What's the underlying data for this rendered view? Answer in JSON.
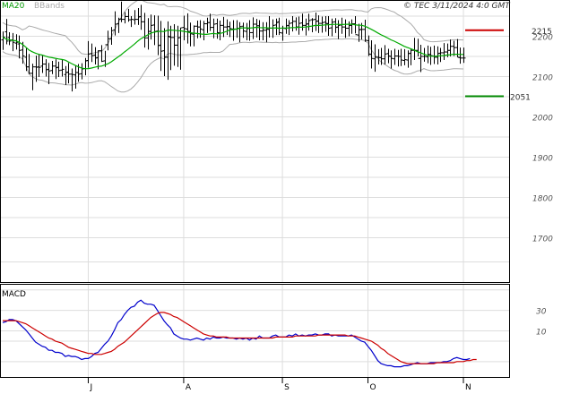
{
  "header": {
    "legend_ma": "MA20",
    "legend_bb": "BBands",
    "watermark": "© TEC 3/11/2024 4:0 GMT"
  },
  "macd_label": "MACD",
  "colors": {
    "price": "#000000",
    "ma20": "#00aa00",
    "bbands": "#aaaaaa",
    "resistance": "#cc0000",
    "support": "#008800",
    "macd": "#0000cc",
    "signal": "#cc0000",
    "grid": "#dddddd",
    "panel_border": "#000000"
  },
  "chart_data": [
    {
      "type": "ohlc",
      "ylim": [
        1590,
        2290
      ],
      "yticks": [
        1700,
        1800,
        1900,
        2000,
        2100,
        2200
      ],
      "x_months": [
        {
          "label": "J",
          "index": 26
        },
        {
          "label": "A",
          "index": 55
        },
        {
          "label": "S",
          "index": 85
        },
        {
          "label": "O",
          "index": 111
        },
        {
          "label": "N",
          "index": 140
        }
      ],
      "levels": [
        {
          "name": "resistance",
          "value": 2215,
          "label": "2215"
        },
        {
          "name": "support",
          "value": 2051,
          "label": "2051"
        }
      ],
      "series": {
        "high": [
          2212,
          2243,
          2210,
          2208,
          2205,
          2202,
          2186,
          2170,
          2156,
          2132,
          2152,
          2156,
          2152,
          2143,
          2134,
          2139,
          2143,
          2137,
          2142,
          2126,
          2134,
          2120,
          2128,
          2131,
          2133,
          2146,
          2188,
          2182,
          2173,
          2165,
          2178,
          2164,
          2214,
          2223,
          2262,
          2246,
          2286,
          2260,
          2268,
          2250,
          2265,
          2270,
          2278,
          2258,
          2245,
          2254,
          2252,
          2251,
          2238,
          2220,
          2237,
          2226,
          2230,
          2226,
          2221,
          2251,
          2257,
          2234,
          2227,
          2239,
          2240,
          2238,
          2246,
          2256,
          2244,
          2244,
          2239,
          2248,
          2242,
          2236,
          2240,
          2240,
          2235,
          2234,
          2233,
          2240,
          2247,
          2243,
          2240,
          2235,
          2235,
          2250,
          2242,
          2244,
          2246,
          2226,
          2244,
          2240,
          2250,
          2247,
          2249,
          2256,
          2244,
          2256,
          2245,
          2259,
          2252,
          2249,
          2250,
          2250,
          2244,
          2245,
          2240,
          2246,
          2242,
          2237,
          2242,
          2250,
          2231,
          2233,
          2241,
          2202,
          2190,
          2180,
          2168,
          2171,
          2178,
          2169,
          2165,
          2169,
          2166,
          2169,
          2168,
          2165,
          2168,
          2196,
          2194,
          2179,
          2171,
          2177,
          2174,
          2177,
          2175,
          2171,
          2183,
          2182,
          2192,
          2189,
          2193,
          2172,
          2172
        ],
        "low": [
          2166,
          2180,
          2178,
          2163,
          2167,
          2145,
          2132,
          2114,
          2106,
          2066,
          2087,
          2099,
          2109,
          2100,
          2081,
          2106,
          2094,
          2099,
          2100,
          2079,
          2083,
          2063,
          2070,
          2087,
          2093,
          2103,
          2122,
          2136,
          2130,
          2118,
          2136,
          2124,
          2165,
          2179,
          2202,
          2208,
          2235,
          2232,
          2236,
          2223,
          2229,
          2228,
          2216,
          2172,
          2167,
          2192,
          2178,
          2153,
          2114,
          2101,
          2092,
          2116,
          2127,
          2124,
          2117,
          2190,
          2182,
          2175,
          2175,
          2195,
          2196,
          2190,
          2208,
          2213,
          2195,
          2194,
          2190,
          2198,
          2203,
          2198,
          2189,
          2196,
          2185,
          2196,
          2190,
          2189,
          2193,
          2197,
          2190,
          2190,
          2185,
          2197,
          2196,
          2203,
          2203,
          2189,
          2206,
          2203,
          2212,
          2214,
          2204,
          2214,
          2202,
          2214,
          2210,
          2213,
          2208,
          2209,
          2211,
          2201,
          2200,
          2208,
          2193,
          2206,
          2196,
          2200,
          2206,
          2207,
          2186,
          2192,
          2186,
          2151,
          2120,
          2112,
          2130,
          2129,
          2130,
          2133,
          2120,
          2129,
          2125,
          2126,
          2128,
          2122,
          2128,
          2141,
          2150,
          2111,
          2137,
          2133,
          2129,
          2131,
          2130,
          2136,
          2141,
          2148,
          2150,
          2151,
          2148,
          2132,
          2134
        ],
        "open": [
          2191,
          2211,
          2197,
          2191,
          2183,
          2181,
          2166,
          2148,
          2124,
          2108,
          2124,
          2124,
          2126,
          2131,
          2118,
          2115,
          2126,
          2123,
          2116,
          2105,
          2111,
          2106,
          2104,
          2110,
          2107,
          2120,
          2140,
          2157,
          2153,
          2147,
          2164,
          2139,
          2179,
          2194,
          2216,
          2231,
          2243,
          2242,
          2249,
          2241,
          2241,
          2242,
          2249,
          2236,
          2196,
          2212,
          2228,
          2213,
          2178,
          2164,
          2148,
          2198,
          2197,
          2178,
          2197,
          2222,
          2218,
          2212,
          2205,
          2225,
          2223,
          2216,
          2231,
          2234,
          2222,
          2231,
          2208,
          2227,
          2223,
          2224,
          2218,
          2218,
          2220,
          2225,
          2212,
          2220,
          2209,
          2230,
          2226,
          2213,
          2215,
          2217,
          2220,
          2228,
          2236,
          2208,
          2219,
          2227,
          2233,
          2237,
          2223,
          2233,
          2227,
          2231,
          2241,
          2242,
          2238,
          2232,
          2235,
          2231,
          2221,
          2236,
          2223,
          2228,
          2223,
          2220,
          2227,
          2231,
          2203,
          2217,
          2217,
          2189,
          2155,
          2144,
          2148,
          2147,
          2144,
          2157,
          2150,
          2144,
          2151,
          2150,
          2140,
          2141,
          2158,
          2165,
          2165,
          2145,
          2150,
          2149,
          2155,
          2151,
          2148,
          2158,
          2159,
          2161,
          2165,
          2175,
          2172,
          2147,
          2146
        ],
        "close": [
          2198,
          2188,
          2188,
          2185,
          2185,
          2165,
          2151,
          2124,
          2108,
          2124,
          2123,
          2123,
          2131,
          2117,
          2114,
          2126,
          2122,
          2115,
          2118,
          2110,
          2106,
          2105,
          2110,
          2106,
          2119,
          2139,
          2156,
          2152,
          2146,
          2164,
          2138,
          2179,
          2194,
          2214,
          2230,
          2242,
          2242,
          2249,
          2241,
          2242,
          2242,
          2248,
          2236,
          2196,
          2212,
          2227,
          2212,
          2177,
          2163,
          2148,
          2200,
          2197,
          2178,
          2196,
          2221,
          2219,
          2212,
          2206,
          2225,
          2223,
          2218,
          2231,
          2234,
          2222,
          2230,
          2209,
          2227,
          2223,
          2224,
          2219,
          2218,
          2220,
          2224,
          2213,
          2219,
          2209,
          2230,
          2226,
          2213,
          2215,
          2218,
          2220,
          2227,
          2234,
          2209,
          2220,
          2226,
          2232,
          2237,
          2223,
          2232,
          2227,
          2230,
          2239,
          2241,
          2237,
          2232,
          2234,
          2232,
          2220,
          2235,
          2222,
          2227,
          2223,
          2220,
          2227,
          2231,
          2204,
          2216,
          2217,
          2190,
          2156,
          2145,
          2148,
          2147,
          2144,
          2156,
          2151,
          2145,
          2151,
          2150,
          2141,
          2142,
          2157,
          2165,
          2165,
          2145,
          2150,
          2150,
          2155,
          2152,
          2148,
          2157,
          2159,
          2161,
          2165,
          2175,
          2172,
          2148,
          2146,
          2146
        ]
      }
    },
    {
      "type": "line",
      "title": "MACD",
      "ylim": [
        -35,
        55
      ],
      "yticks": [
        10,
        30
      ],
      "series": [
        {
          "key": "macd",
          "values": [
            18,
            19,
            21,
            21,
            20,
            17,
            14,
            11,
            7,
            3,
            -1,
            -3,
            -5,
            -6,
            -9,
            -9,
            -11,
            -11,
            -12,
            -15,
            -14,
            -15,
            -15,
            -16,
            -18,
            -17,
            -17,
            -15,
            -12,
            -11,
            -7,
            -3,
            0,
            5,
            11,
            18,
            21,
            26,
            30,
            33,
            34,
            38,
            40,
            37,
            36,
            36,
            35,
            30,
            25,
            20,
            16,
            13,
            7,
            5,
            3,
            2,
            2,
            1,
            2,
            3,
            2,
            1,
            3,
            2,
            4,
            3,
            3,
            4,
            3,
            3,
            3,
            2,
            3,
            2,
            3,
            1,
            3,
            2,
            5,
            3,
            3,
            3,
            5,
            6,
            4,
            4,
            4,
            6,
            5,
            7,
            5,
            6,
            5,
            6,
            6,
            7,
            6,
            6,
            7,
            7,
            5,
            6,
            5,
            5,
            5,
            5,
            6,
            4,
            2,
            0,
            -1,
            -5,
            -9,
            -14,
            -19,
            -22,
            -23,
            -24,
            -24,
            -25,
            -25,
            -25,
            -24,
            -24,
            -23,
            -22,
            -21,
            -22,
            -22,
            -22,
            -21,
            -21,
            -21,
            -21,
            -20,
            -20,
            -19,
            -17,
            -16,
            -17,
            -18,
            -18,
            -17
          ]
        },
        {
          "key": "signal",
          "values": [
            20,
            20,
            20,
            20,
            20,
            19,
            18,
            17,
            15,
            13,
            11,
            9,
            7,
            5,
            3,
            2,
            0,
            -1,
            -2,
            -4,
            -6,
            -7,
            -8,
            -9,
            -10,
            -11,
            -12,
            -12,
            -13,
            -13,
            -13,
            -12,
            -11,
            -10,
            -8,
            -5,
            -3,
            -1,
            2,
            5,
            8,
            11,
            14,
            17,
            20,
            23,
            25,
            27,
            28,
            28,
            27,
            26,
            24,
            23,
            21,
            19,
            17,
            15,
            13,
            11,
            9,
            7,
            6,
            5,
            5,
            4,
            4,
            4,
            4,
            3,
            3,
            3,
            3,
            3,
            3,
            3,
            3,
            3,
            3,
            3,
            3,
            3,
            3,
            4,
            4,
            4,
            4,
            4,
            4,
            5,
            5,
            5,
            5,
            5,
            5,
            5,
            6,
            6,
            6,
            6,
            6,
            6,
            6,
            6,
            6,
            5,
            5,
            5,
            4,
            3,
            2,
            1,
            0,
            -2,
            -4,
            -7,
            -9,
            -12,
            -14,
            -16,
            -18,
            -20,
            -21,
            -22,
            -22,
            -22,
            -22,
            -22,
            -22,
            -22,
            -22,
            -22,
            -21,
            -21,
            -21,
            -21,
            -21,
            -21,
            -20,
            -20,
            -20,
            -19,
            -19,
            -18,
            -18
          ]
        }
      ]
    }
  ]
}
